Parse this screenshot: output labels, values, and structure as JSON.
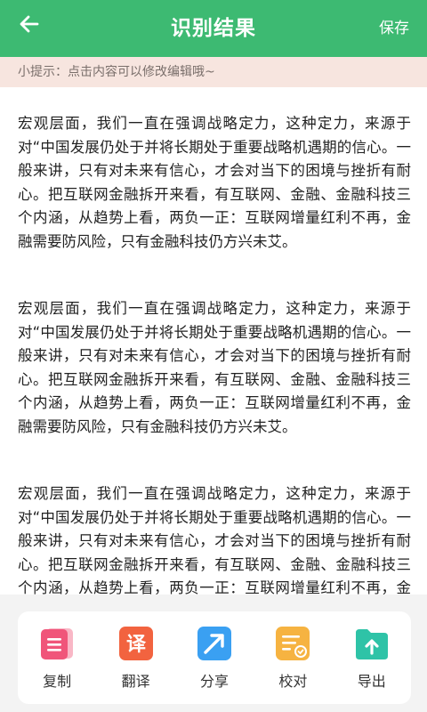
{
  "header": {
    "title": "识别结果",
    "save_label": "保存"
  },
  "tip": "小提示：点击内容可以修改编辑哦~",
  "paragraphs": [
    "宏观层面，我们一直在强调战略定力，这种定力，来源于对“中国发展仍处于并将长期处于重要战略机遇期的信心。一般来讲，只有对未来有信心，才会对当下的困境与挫折有耐心。把互联网金融拆开来看，有互联网、金融、金融科技三个内涵，从趋势上看，两负一正：互联网增量红利不再，金融需要防风险，只有金融科技仍方兴未艾。",
    "宏观层面，我们一直在强调战略定力，这种定力，来源于对“中国发展仍处于并将长期处于重要战略机遇期的信心。一般来讲，只有对未来有信心，才会对当下的困境与挫折有耐心。把互联网金融拆开来看，有互联网、金融、金融科技三个内涵，从趋势上看，两负一正：互联网增量红利不再，金融需要防风险，只有金融科技仍方兴未艾。",
    "宏观层面，我们一直在强调战略定力，这种定力，来源于对“中国发展仍处于并将长期处于重要战略机遇期的信心。一般来讲，只有对未来有信心，才会对当下的困境与挫折有耐心。把互联网金融拆开来看，有互联网、金融、金融科技三个内涵，从趋势上看，两负一正：互联网增量红利不再，金融需要防风险，只有金融科技仍方兴未艾。"
  ],
  "toolbar": {
    "copy": "复制",
    "translate": "翻译",
    "translate_glyph": "译",
    "share": "分享",
    "proofread": "校对",
    "export": "导出"
  },
  "colors": {
    "header": "#3dba72",
    "tip_bg": "#f7e5df",
    "copy": "#f0557a",
    "translate": "#f2633f",
    "share": "#3aa0f2",
    "proofread": "#f6b341",
    "export": "#2ec3a7"
  }
}
